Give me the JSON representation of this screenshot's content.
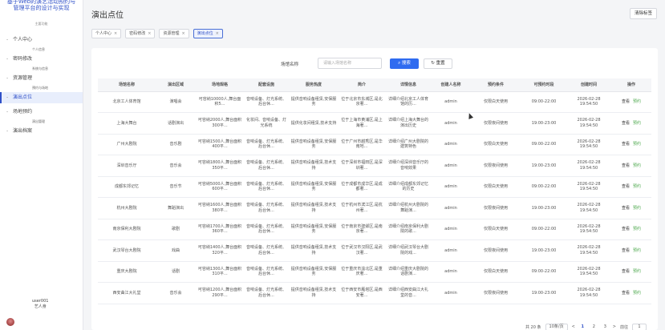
{
  "sidebar": {
    "brand_title": "基于Web的演艺活动预约与管理平台的设计与实现",
    "brand_sub": "主要功能",
    "items": [
      {
        "label": "个人中心",
        "sub": "个人信息",
        "active": false
      },
      {
        "label": "密码修改",
        "sub": "系统与信息",
        "active": false
      },
      {
        "label": "资源管理",
        "sub": "预约与场地",
        "active": false
      },
      {
        "label": "演出点位",
        "sub": "",
        "active": true
      },
      {
        "label": "场地预约",
        "sub": "演出管理",
        "active": false
      },
      {
        "label": "演出档案",
        "sub": "",
        "active": false
      }
    ],
    "user_line1": "user001",
    "user_line2": "艺人身"
  },
  "header": {
    "title": "演出点位",
    "clear_label": "清除标签"
  },
  "tabs": [
    {
      "label": "个人中心",
      "active": false
    },
    {
      "label": "密码修改",
      "active": false
    },
    {
      "label": "资源管理",
      "active": false
    },
    {
      "label": "演出点位",
      "active": true
    }
  ],
  "search": {
    "label": "场馆名称",
    "placeholder": "请输入场馆名称",
    "search_label": "搜索",
    "reset_label": "重置"
  },
  "table": {
    "headers": [
      "场馆名称",
      "演出区域",
      "场地规格",
      "配套设施",
      "服务热度",
      "简介",
      "详情信息",
      "创建人名称",
      "预约条件",
      "可预约时段",
      "创建时间",
      "操作"
    ],
    "rows": [
      [
        "北京工人体育馆",
        "演唱会",
        "可容纳10000人,舞台面积5...",
        "音响设备、灯光系统、后台休...",
        "提供音响设备租赁,安保服务",
        "位于北京市东城区,是北京著...",
        "详细介绍北京工人体育馆的历...",
        "admin",
        "仅限白天使用",
        "09:00-22:00",
        "2026-02-28 19:54:50"
      ],
      [
        "上海大舞台",
        "话剧演出",
        "可容纳2000人,舞台面积300平...",
        "化妆间、音响设备、灯光系统",
        "提供化妆间租赁,技术支持",
        "位于上海市黄浦区,是上海著...",
        "详细介绍上海大舞台的演出历史",
        "admin",
        "仅限夜间使用",
        "19:00-23:00",
        "2026-02-28 19:54:50"
      ],
      [
        "广州大剧院",
        "音乐剧",
        "可容纳1500人,舞台面积400平...",
        "音响设备、灯光系统、后台休...",
        "提供音响设备租赁,安保服务",
        "位于广州市越秀区,是华南地...",
        "详细介绍广州大剧院的建筑特色",
        "admin",
        "仅限白天使用",
        "09:00-22:00",
        "2026-02-28 19:54:50"
      ],
      [
        "深圳音乐厅",
        "音乐会",
        "可容纳1800人,舞台面积350平...",
        "音响设备、灯光系统、后台休...",
        "提供音响设备租赁,技术支持",
        "位于深圳市福田区,是深圳著...",
        "详细介绍深圳音乐厅的音响效果",
        "admin",
        "仅限夜间使用",
        "19:00-23:00",
        "2026-02-28 19:54:50"
      ],
      [
        "成都东郊记忆",
        "音乐节",
        "可容纳5000人,舞台面积600平...",
        "音响设备、灯光系统、后台休...",
        "提供音响设备租赁,安保服务",
        "位于成都市成华区,是成都著...",
        "详细介绍成都东郊记忆的历史",
        "admin",
        "仅限白天使用",
        "09:00-22:00",
        "2026-02-28 19:54:50"
      ],
      [
        "杭州大剧院",
        "舞蹈演出",
        "可容纳1600人,舞台面积380平...",
        "音响设备、灯光系统、后台休...",
        "提供音响设备租赁,技术支持",
        "位于杭州市滨江区,是杭州著...",
        "详细介绍杭州大剧院的舞蹈演...",
        "admin",
        "仅限夜间使用",
        "19:00-23:00",
        "2026-02-28 19:54:50"
      ],
      [
        "南京保利大剧院",
        "歌剧",
        "可容纳1700人,舞台面积360平...",
        "音响设备、灯光系统、后台休...",
        "提供音响设备租赁,安保服务",
        "位于南京市建邺区,是南京著...",
        "详细介绍南京保利大剧院的歌...",
        "admin",
        "仅限白天使用",
        "09:00-22:00",
        "2026-02-28 19:54:50"
      ],
      [
        "武汉琴台大剧院",
        "戏曲",
        "可容纳1400人,舞台面积320平...",
        "音响设备、灯光系统、后台休...",
        "提供音响设备租赁,技术支持",
        "位于武汉市汉阳区,是武汉著...",
        "详细介绍武汉琴台大剧院的戏...",
        "admin",
        "仅限夜间使用",
        "19:00-23:00",
        "2026-02-28 19:54:50"
      ],
      [
        "重庆大剧院",
        "话剧",
        "可容纳1300人,舞台面积310平...",
        "音响设备、灯光系统、后台休...",
        "提供音响设备租赁,安保服务",
        "位于重庆市渝北区,是重庆著...",
        "详细介绍重庆大剧院的话剧演...",
        "admin",
        "仅限白天使用",
        "09:00-22:00",
        "2026-02-28 19:54:50"
      ],
      [
        "西安曲江大礼堂",
        "音乐会",
        "可容纳1200人,舞台面积290平...",
        "音响设备、灯光系统、后台休...",
        "提供音响设备租赁,技术支持",
        "位于西安市雁塔区,是西安著...",
        "详细介绍西安曲江大礼堂的音...",
        "admin",
        "仅限夜间使用",
        "19:00-23:00",
        "2026-02-28 19:54:50"
      ]
    ],
    "op_view": "查看",
    "op_book": "预约"
  },
  "pager": {
    "total": "共 20 条",
    "page_size": "10条/页",
    "prev": "<",
    "pages": [
      "1",
      "2",
      "3"
    ],
    "next": ">",
    "goto_label": "前往",
    "goto_value": "1"
  },
  "colors": {
    "primary": "#2f6bf0",
    "book": "#4ca84c"
  }
}
